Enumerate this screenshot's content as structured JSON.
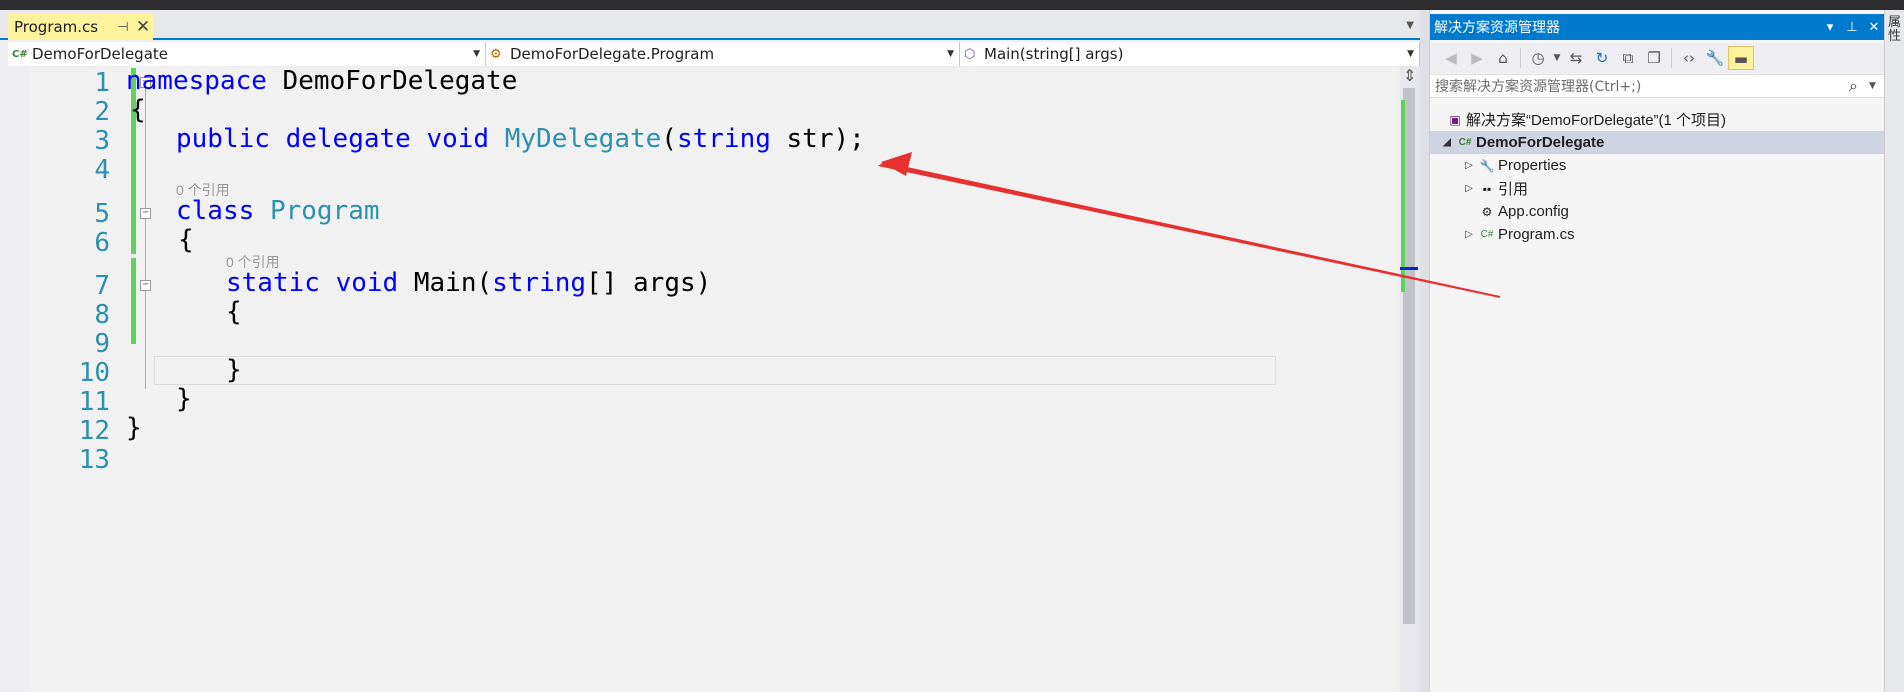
{
  "editor": {
    "tab": {
      "title": "Program.cs",
      "pin_glyph": "⊣",
      "close_glyph": "✕"
    },
    "nav": {
      "project": "DemoForDelegate",
      "type": "DemoForDelegate.Program",
      "member": "Main(string[] args)"
    },
    "line_numbers": [
      "1",
      "2",
      "3",
      "4",
      "5",
      "6",
      "7",
      "8",
      "9",
      "10",
      "11",
      "12",
      "13"
    ],
    "hints": {
      "class_refs": "0 个引用",
      "main_refs": "0 个引用"
    },
    "code": {
      "l1_kw": "namespace",
      "l1_rest": " DemoForDelegate",
      "l2": "{",
      "l3_kw1": "public",
      "l3_kw2": "delegate",
      "l3_kw3": "void",
      "l3_type": "MyDelegate",
      "l3_p1": "(",
      "l3_kw4": "string",
      "l3_rest": " str);",
      "l5_kw": "class",
      "l5_type": "Program",
      "l6": "{",
      "l7_kw1": "static",
      "l7_kw2": "void",
      "l7_name": " Main(",
      "l7_kw3": "string",
      "l7_rest": "[] args)",
      "l8": "{",
      "l10": "}",
      "l11": "}",
      "l12": "}"
    }
  },
  "solution_explorer": {
    "title": "解决方案资源管理器",
    "title_buttons": {
      "dropdown": "▾",
      "pin": "⊥",
      "close": "✕"
    },
    "search_placeholder": "搜索解决方案资源管理器(Ctrl+;)",
    "tree": {
      "solution": "解决方案“DemoForDelegate”(1 个项目)",
      "project": "DemoForDelegate",
      "properties": "Properties",
      "references": "引用",
      "appconfig": "App.config",
      "program": "Program.cs"
    }
  },
  "right_edge": {
    "label": "属性"
  },
  "colors": {
    "accent": "#007acc",
    "keyword": "#0000ff",
    "type": "#2b91af",
    "tab_active": "#fff29d",
    "change_bar": "#5fd35f",
    "annotation": "#e8312f"
  },
  "icons": [
    "csharp-file-icon",
    "class-icon",
    "method-icon",
    "back-icon",
    "forward-icon",
    "home-icon",
    "history-icon",
    "sync-icon",
    "refresh-icon",
    "collapse-icon",
    "copy-icon",
    "code-icon",
    "wrench-icon",
    "preview-icon",
    "search-icon"
  ]
}
